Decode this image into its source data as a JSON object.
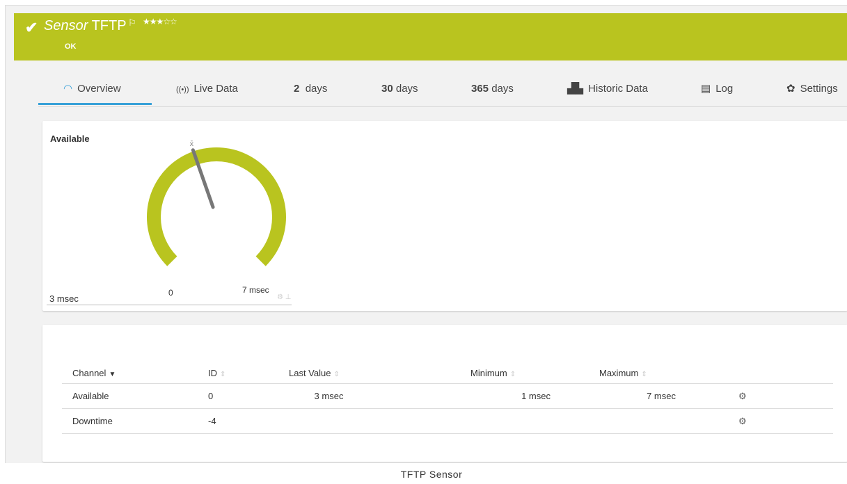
{
  "header": {
    "title_italic": "Sensor",
    "title_name": "TFTP",
    "status": "OK",
    "flag_icon": "flag-icon",
    "priority_stars": 3,
    "priority_stars_max": 5,
    "bg_color": "#b9c41f"
  },
  "tabs": [
    {
      "label": "Overview",
      "icon": "gauge-icon",
      "active": true
    },
    {
      "label": "Live Data",
      "icon": "live-icon"
    },
    {
      "num": "2",
      "label": "days"
    },
    {
      "num": "30",
      "label": "days"
    },
    {
      "num": "365",
      "label": "days"
    },
    {
      "label": "Historic Data",
      "icon": "chart-icon"
    },
    {
      "label": "Log",
      "icon": "log-icon"
    },
    {
      "label": "Settings",
      "icon": "gear-icon"
    }
  ],
  "gauge": {
    "title": "Available",
    "current_value": "3 msec",
    "scale_min": "0",
    "scale_max": "7 msec",
    "avg_marker": "x̄",
    "value": 3,
    "min": 0,
    "max": 7
  },
  "channels": {
    "columns": [
      "Channel",
      "ID",
      "Last Value",
      "Minimum",
      "Maximum"
    ],
    "rows": [
      {
        "channel": "Available",
        "id": "0",
        "last": "3 msec",
        "min": "1 msec",
        "max": "7 msec"
      },
      {
        "channel": "Downtime",
        "id": "-4",
        "last": "",
        "min": "",
        "max": ""
      }
    ]
  },
  "caption": "TFTP Sensor"
}
